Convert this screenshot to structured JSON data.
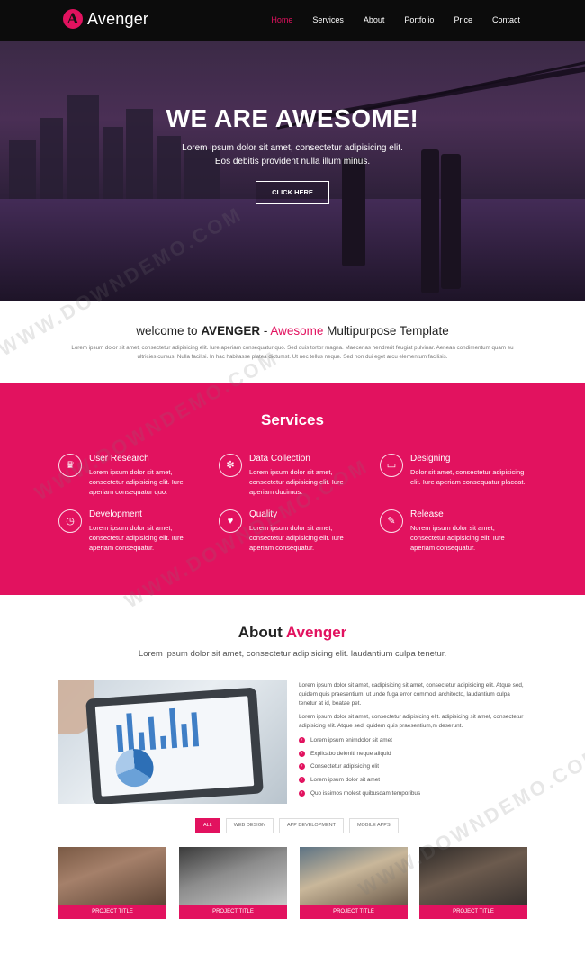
{
  "nav": {
    "brand_letter": "A",
    "brand_name": "Avenger",
    "links": [
      "Home",
      "Services",
      "About",
      "Portfolio",
      "Price",
      "Contact"
    ]
  },
  "hero": {
    "title": "WE ARE AWESOME!",
    "subtitle_line1": "Lorem ipsum dolor sit amet, consectetur adipisicing elit.",
    "subtitle_line2": "Eos debitis provident nulla illum minus.",
    "button": "CLICK HERE"
  },
  "welcome": {
    "prefix": "welcome to ",
    "brand": "AVENGER",
    "dash": " - ",
    "highlight": "Awesome",
    "suffix": " Multipurpose Template",
    "text": "Lorem ipsum dolor sit amet, consectetur adipisicing elit. Iure aperiam consequatur quo. Sed quis tortor magna. Maecenas hendrerit feugiat pulvinar. Aenean condimentum quam eu ultricies cursus. Nulla facilisi. In hac habitasse platea dictumst. Ut nec tellus neque. Sed non dui eget arcu elementum facilisis."
  },
  "services": {
    "title": "Services",
    "items": [
      {
        "icon": "trophy-icon",
        "glyph": "♛",
        "title": "User Research",
        "text": "Lorem ipsum dolor sit amet, consectetur adipisicing elit. Iure aperiam consequatur quo."
      },
      {
        "icon": "gear-icon",
        "glyph": "✻",
        "title": "Data Collection",
        "text": "Lorem ipsum dolor sit amet, consectetur adipisicing elit. Iure aperiam ducimus."
      },
      {
        "icon": "laptop-icon",
        "glyph": "▭",
        "title": "Designing",
        "text": "Dolor sit amet, consectetur adipisicing elit. Iure aperiam consequatur placeat."
      },
      {
        "icon": "clock-icon",
        "glyph": "◷",
        "title": "Development",
        "text": "Lorem ipsum dolor sit amet, consectetur adipisicing elit. Iure aperiam consequatur."
      },
      {
        "icon": "heart-icon",
        "glyph": "♥",
        "title": "Quality",
        "text": "Lorem ipsum dolor sit amet, consectetur adipisicing elit. Iure aperiam consequatur."
      },
      {
        "icon": "wand-icon",
        "glyph": "✎",
        "title": "Release",
        "text": "Norem ipsum dolor sit amet, consectetur adipisicing elit. Iure aperiam consequatur."
      }
    ]
  },
  "about": {
    "title_main": "About ",
    "title_highlight": "Avenger",
    "subtitle": "Lorem ipsum dolor sit amet, consectetur adipisicing elit. laudantium culpa tenetur.",
    "paragraph1": "Lorem ipsum dolor sit amet, cadipisicing sit amet, consectetur adipisicing elit. Atque sed, quidem quis praesentium, ut unde fuga error commodi architecto, laudantium culpa tenetur at id, beatae pet.",
    "paragraph2": "Lorem ipsum dolor sit amet, consectetur adipisicing elit. adipisicing sit amet, consectetur adipisicing elit. Atque sed, quidem quis praesentium,m deserunt.",
    "list": [
      "Lorem ipsum enimdolor sit amet",
      "Explicabo deleniti neque aliquid",
      "Consectetur adipisicing elit",
      "Lorem ipsum dolor sit amet",
      "Quo issimos molest quibusdam temporibus"
    ]
  },
  "portfolio": {
    "filters": [
      "ALL",
      "WEB DESIGN",
      "APP DEVELOPMENT",
      "MOBILE APPS"
    ],
    "projects": [
      "PROJECT TITLE",
      "PROJECT TITLE",
      "PROJECT TITLE",
      "PROJECT TITLE"
    ]
  },
  "watermark": "WWW.DOWNDEMO.COM",
  "colors": {
    "accent": "#e2125f",
    "navbar": "#0c0c0c",
    "hero_tint": "#4a2f55"
  }
}
